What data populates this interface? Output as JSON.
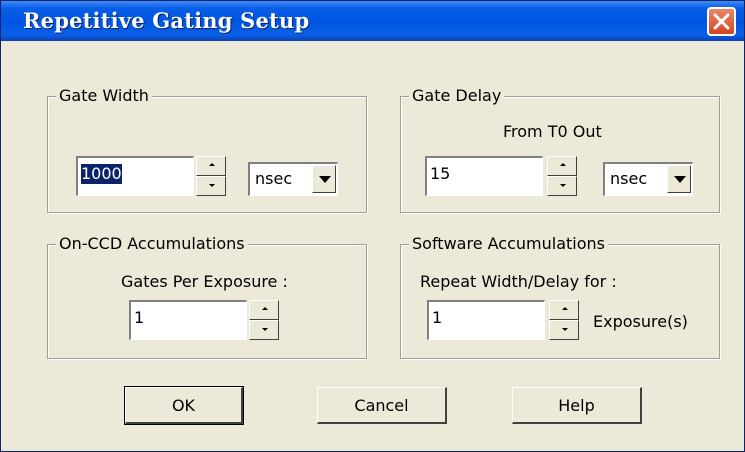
{
  "window": {
    "title": "Repetitive Gating Setup"
  },
  "gate_width": {
    "legend": "Gate Width",
    "value": "1000",
    "unit": "nsec"
  },
  "gate_delay": {
    "legend": "Gate Delay",
    "subtitle": "From T0 Out",
    "value": "15",
    "unit": "nsec"
  },
  "on_ccd": {
    "legend": "On-CCD Accumulations",
    "label": "Gates Per Exposure :",
    "value": "1"
  },
  "software": {
    "legend": "Software Accumulations",
    "label": "Repeat Width/Delay for :",
    "value": "1",
    "suffix": "Exposure(s)"
  },
  "buttons": {
    "ok": "OK",
    "cancel": "Cancel",
    "help": "Help"
  },
  "colors": {
    "titlebar": "#0054e3",
    "close": "#d2451f",
    "face": "#ece9d8",
    "selection": "#0a246a"
  },
  "icons": {
    "close": "close-icon",
    "spin_up": "spin-up-arrow-icon",
    "spin_down": "spin-down-arrow-icon",
    "dropdown": "chevron-down-icon"
  }
}
